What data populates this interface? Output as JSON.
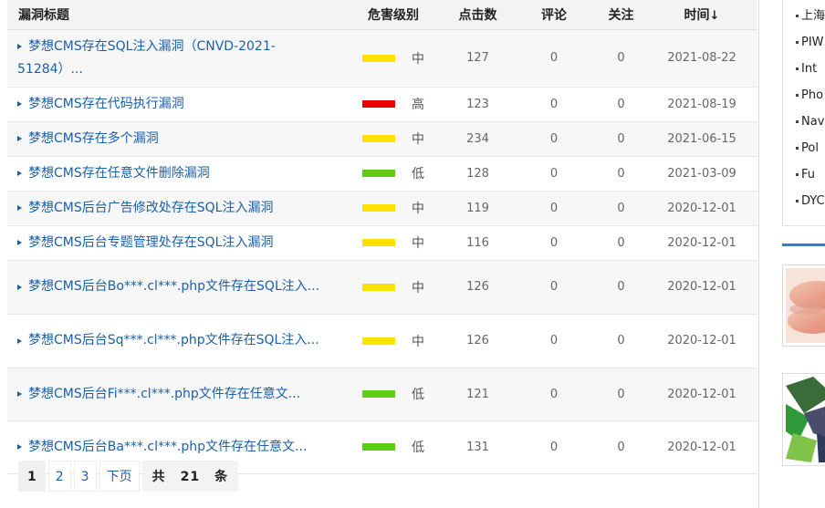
{
  "table": {
    "headers": {
      "title": "漏洞标题",
      "level": "危害级别",
      "clicks": "点击数",
      "comments": "评论",
      "follows": "关注",
      "time": "时间",
      "time_sort": "↓"
    },
    "level_colors": {
      "高": "#e60000",
      "中": "#ffe100",
      "低": "#5fcc12"
    },
    "rows": [
      {
        "title": "梦想CMS存在SQL注入漏洞（CNVD-2021-51284）...",
        "level": "中",
        "clicks": "127",
        "comments": "0",
        "follows": "0",
        "time": "2021-08-22"
      },
      {
        "title": "梦想CMS存在代码执行漏洞",
        "level": "高",
        "clicks": "123",
        "comments": "0",
        "follows": "0",
        "time": "2021-08-19"
      },
      {
        "title": "梦想CMS存在多个漏洞",
        "level": "中",
        "clicks": "234",
        "comments": "0",
        "follows": "0",
        "time": "2021-06-15"
      },
      {
        "title": "梦想CMS存在任意文件删除漏洞",
        "level": "低",
        "clicks": "128",
        "comments": "0",
        "follows": "0",
        "time": "2021-03-09"
      },
      {
        "title": "梦想CMS后台广告修改处存在SQL注入漏洞",
        "level": "中",
        "clicks": "119",
        "comments": "0",
        "follows": "0",
        "time": "2020-12-01"
      },
      {
        "title": "梦想CMS后台专题管理处存在SQL注入漏洞",
        "level": "中",
        "clicks": "116",
        "comments": "0",
        "follows": "0",
        "time": "2020-12-01"
      },
      {
        "title": "梦想CMS后台Bo***.cl***.php文件存在SQL注入...",
        "level": "中",
        "clicks": "126",
        "comments": "0",
        "follows": "0",
        "time": "2020-12-01"
      },
      {
        "title": "梦想CMS后台Sq***.cl***.php文件存在SQL注入...",
        "level": "中",
        "clicks": "126",
        "comments": "0",
        "follows": "0",
        "time": "2020-12-01"
      },
      {
        "title": "梦想CMS后台Fi***.cl***.php文件存在任意文...",
        "level": "低",
        "clicks": "121",
        "comments": "0",
        "follows": "0",
        "time": "2020-12-01"
      },
      {
        "title": "梦想CMS后台Ba***.cl***.php文件存在任意文...",
        "level": "低",
        "clicks": "131",
        "comments": "0",
        "follows": "0",
        "time": "2020-12-01"
      }
    ]
  },
  "pagination": {
    "pages": [
      "1",
      "2",
      "3"
    ],
    "current": "1",
    "next": "下页",
    "total_prefix": "共",
    "total_count": "21",
    "total_suffix": "条"
  },
  "sidebar": {
    "items": [
      "上海",
      "PIW",
      "Int",
      "Pho",
      "Nav",
      "Pol",
      "Fu",
      "DYC"
    ]
  },
  "colors": {
    "link": "#1a5fa8",
    "accent": "#2f7fd0"
  }
}
